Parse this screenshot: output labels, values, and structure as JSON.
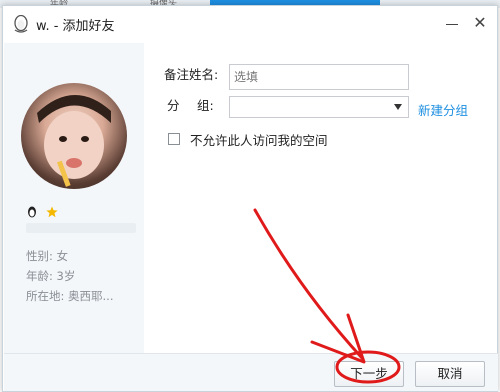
{
  "background": {
    "tab_left": "年龄",
    "tab_right": "摄像头"
  },
  "dialog": {
    "title": "w. - 添加好友",
    "minimize_icon": "minimize-icon",
    "close_icon": "close-icon",
    "close_glyph": "✕"
  },
  "profile": {
    "badges": [
      "qq-penguin-icon",
      "star-level-icon"
    ],
    "gender": "性别: 女",
    "age": "年龄: 3岁",
    "location": "所在地:  奥西耶..."
  },
  "form": {
    "remark_label": "备注姓名:",
    "remark_placeholder": "选填",
    "group_label_1": "分",
    "group_label_2": "组:",
    "group_value": "",
    "new_group_link": "新建分组",
    "privacy_checkbox_label": "不允许此人访问我的空间",
    "privacy_checked": false
  },
  "footer": {
    "next_label": "下一步",
    "cancel_label": "取消"
  },
  "colors": {
    "accent": "#1e8fe1",
    "annotation": "#e01a1a"
  }
}
